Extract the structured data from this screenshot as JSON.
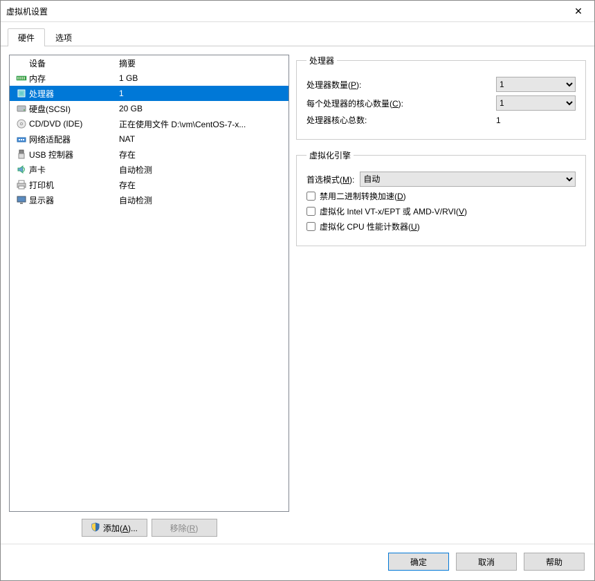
{
  "window": {
    "title": "虚拟机设置"
  },
  "tabs": {
    "hardware": "硬件",
    "options": "选项"
  },
  "device_table": {
    "col_device": "设备",
    "col_summary": "摘要"
  },
  "devices": [
    {
      "name": "内存",
      "summary": "1 GB",
      "icon": "memory-icon"
    },
    {
      "name": "处理器",
      "summary": "1",
      "icon": "cpu-icon",
      "selected": true
    },
    {
      "name": "硬盘(SCSI)",
      "summary": "20 GB",
      "icon": "disk-icon"
    },
    {
      "name": "CD/DVD (IDE)",
      "summary": "正在使用文件 D:\\vm\\CentOS-7-x...",
      "icon": "cd-icon"
    },
    {
      "name": "网络适配器",
      "summary": "NAT",
      "icon": "network-icon"
    },
    {
      "name": "USB 控制器",
      "summary": "存在",
      "icon": "usb-icon"
    },
    {
      "name": "声卡",
      "summary": "自动检测",
      "icon": "sound-icon"
    },
    {
      "name": "打印机",
      "summary": "存在",
      "icon": "printer-icon"
    },
    {
      "name": "显示器",
      "summary": "自动检测",
      "icon": "display-icon"
    }
  ],
  "list_buttons": {
    "add": "添加(A)...",
    "remove": "移除(R)"
  },
  "proc_group": {
    "legend": "处理器",
    "num_processors_label": "处理器数量(P):",
    "num_processors_value": "1",
    "cores_per_proc_label": "每个处理器的核心数量(C):",
    "cores_per_proc_value": "1",
    "total_cores_label": "处理器核心总数:",
    "total_cores_value": "1"
  },
  "virt_group": {
    "legend": "虚拟化引擎",
    "preferred_mode_label": "首选模式(M):",
    "preferred_mode_value": "自动",
    "disable_binary_label": "禁用二进制转换加速(D)",
    "vt_label": "虚拟化 Intel VT-x/EPT 或 AMD-V/RVI(V)",
    "perf_counters_label": "虚拟化 CPU 性能计数器(U)"
  },
  "buttons": {
    "ok": "确定",
    "cancel": "取消",
    "help": "帮助"
  }
}
